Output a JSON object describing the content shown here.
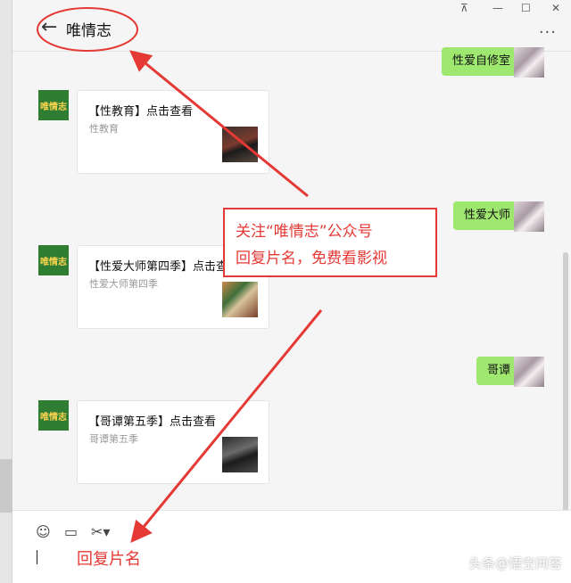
{
  "window": {
    "title": "唯情志",
    "pin": "⊼",
    "minimize": "—",
    "maximize": "☐",
    "close": "✕",
    "more": "···"
  },
  "icons": {
    "back": "arrow-left-icon",
    "emoji": "emoji-icon",
    "folder": "folder-icon",
    "scissors": "scissors-icon"
  },
  "left_avatar_text": "唯情志",
  "messages": [
    {
      "type": "text",
      "side": "right",
      "text": "性爱自修室"
    },
    {
      "type": "card",
      "side": "left",
      "title": "【性教育】点击查看",
      "subtitle": "性教育"
    },
    {
      "type": "text",
      "side": "right",
      "text": "性爱大师"
    },
    {
      "type": "card",
      "side": "left",
      "title": "【性爱大师第四季】点击查看",
      "subtitle": "性爱大师第四季"
    },
    {
      "type": "text",
      "side": "right",
      "text": "哥谭"
    },
    {
      "type": "card",
      "side": "left",
      "title": "【哥谭第五季】点击查看",
      "subtitle": "哥谭第五季"
    }
  ],
  "overlay": {
    "line1": "关注“唯情志”公众号",
    "line2": "回复片名，免费看影视"
  },
  "input_hint": "回复片名",
  "watermark": "头条@悟空问答",
  "colors": {
    "accent_red": "#e53935",
    "bubble_green": "#9fe870",
    "avatar_green": "#2e7d32"
  }
}
